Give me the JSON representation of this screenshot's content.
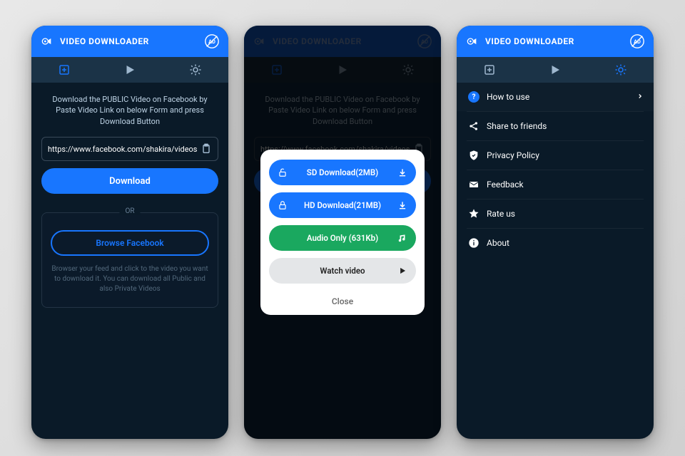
{
  "app": {
    "title": "VIDEO DOWNLOADER"
  },
  "screen1": {
    "instruction": "Download the PUBLIC Video on Facebook by Paste Video Link on below Form and press Download Button",
    "url_value": "https://www.facebook.com/shakira/videos",
    "download_label": "Download",
    "or_label": "OR",
    "browse_label": "Browse Facebook",
    "browse_hint": "Browser your feed and click to the video you want to download it. You can download all Public and also Private Videos"
  },
  "screen2": {
    "options": {
      "sd": "SD Download(2MB)",
      "hd": "HD Download(21MB)",
      "audio": "Audio Only (631Kb)",
      "watch": "Watch video"
    },
    "close": "Close"
  },
  "screen3": {
    "items": {
      "howto": "How to use",
      "share": "Share to friends",
      "privacy": "Privacy Policy",
      "feedback": "Feedback",
      "rate": "Rate us",
      "about": "About"
    }
  }
}
